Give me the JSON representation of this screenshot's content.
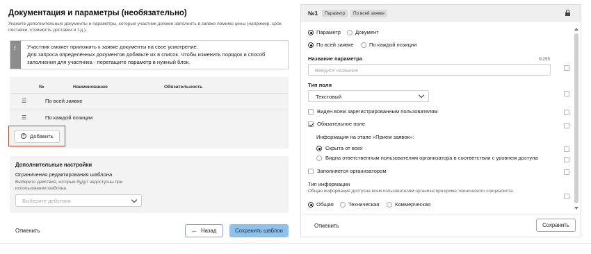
{
  "left": {
    "title": "Документация и параметры (необязательно)",
    "subtitle": "Укажите дополнительные документы и параметры, которые участник должен заполнить в заявке помимо цены (например, срок поставки, стоимость доставки и т.д.).",
    "info_icon": "!",
    "info_lines": [
      "Участник сможет приложить к заявке документы на свое усмотрение.",
      "Для запроса определённых документов добавьте их в список. Чтобы изменить порядок и способ",
      "заполнения для участника - перетащите параметр в нужный блок."
    ],
    "table": {
      "col_num": "№",
      "col_name": "Наименование",
      "col_required": "Обязательность",
      "rows": [
        {
          "icon": "drag-handle-icon",
          "label": "По всей заявке"
        },
        {
          "icon": "drag-handle-icon",
          "label": "По каждой позиции"
        }
      ]
    },
    "add_button": "Добавить",
    "settings": {
      "title": "Дополнительные настройки",
      "subtitle": "Ограничения редактирования шаблона",
      "hint": "Выберите действия, которые будут недоступны при использовании шаблона.",
      "select_placeholder": "Выберите действия"
    },
    "cancel": "Отменить",
    "back": "Назад",
    "save_template": "Сохранить шаблон"
  },
  "right": {
    "number": "№1",
    "tag_param": "Параметр",
    "tag_scope": "По всей заявке",
    "kind_options": [
      "Параметр",
      "Документ"
    ],
    "kind_selected": "Параметр",
    "scope_options": [
      "По всей заявке",
      "По каждой позиции"
    ],
    "scope_selected": "По всей заявке",
    "name_label": "Название параметра",
    "name_counter": "0/255",
    "name_placeholder": "Введите название",
    "field_type_label": "Тип поля",
    "field_type_value": "Текстовый",
    "visible_all": "Виден всем зарегистрированным пользователям",
    "visible_all_checked": false,
    "required": "Обязательное поле",
    "required_checked": true,
    "stage_info_label": "Информация на этапе «Прием заявок»:",
    "stage_options": [
      "Скрыта от всех",
      "Видна ответственным пользователям организатора в соответствии с уровнем доступа"
    ],
    "stage_selected": "Скрыта от всех",
    "filled_by_org": "Заполняется организатором",
    "filled_by_org_checked": false,
    "info_type_label": "Тип информации",
    "info_type_hint": "Общая информация доступна всем пользователям организатора кроме технического специалиста.",
    "info_type_options": [
      "Общая",
      "Техническая",
      "Коммерческая"
    ],
    "info_type_selected": "Общая",
    "cancel": "Отменить",
    "save": "Сохранить"
  },
  "colors": {
    "accent": "#8ec2ea",
    "highlight_frame": "#a5432e",
    "panel_bg": "#f3f3f3"
  }
}
